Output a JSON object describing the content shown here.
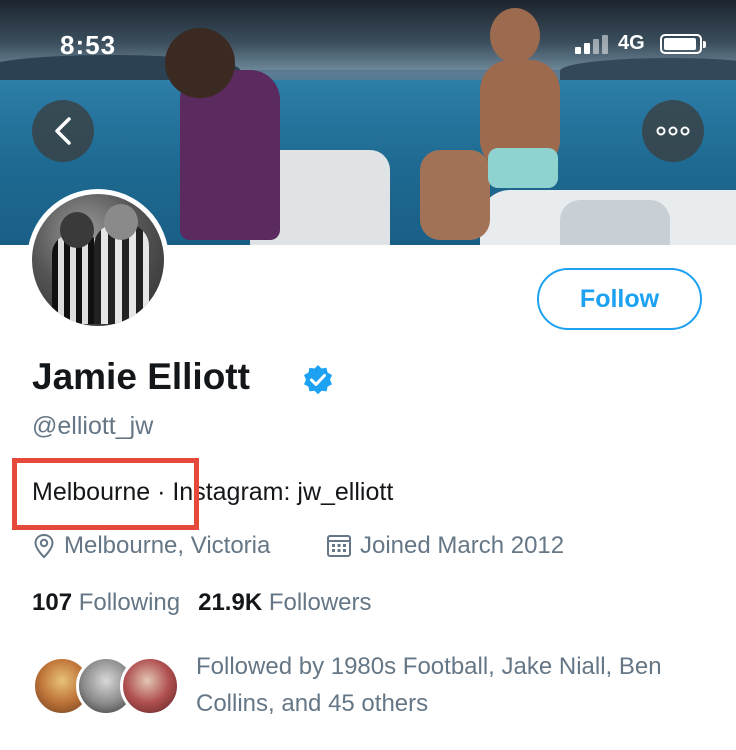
{
  "status_bar": {
    "time": "8:53",
    "network": "4G"
  },
  "header": {
    "back_icon": "chevron-left-icon",
    "more_icon": "more-icon"
  },
  "profile": {
    "name": "Jamie Elliott",
    "verified": true,
    "handle": "@elliott_jw",
    "bio": "Melbourne · Instagram: jw_elliott",
    "location": "Melbourne, Victoria",
    "joined": "Joined March 2012",
    "following_count": "107",
    "following_label": "Following",
    "followers_count": "21.9K",
    "followers_label": "Followers",
    "followed_by": "Followed by 1980s Football, Jake Niall, Ben Collins, and 45 others"
  },
  "actions": {
    "follow_label": "Follow"
  },
  "colors": {
    "accent": "#1da1f2",
    "highlight_box": "#e4493a",
    "secondary_text": "#657786"
  }
}
